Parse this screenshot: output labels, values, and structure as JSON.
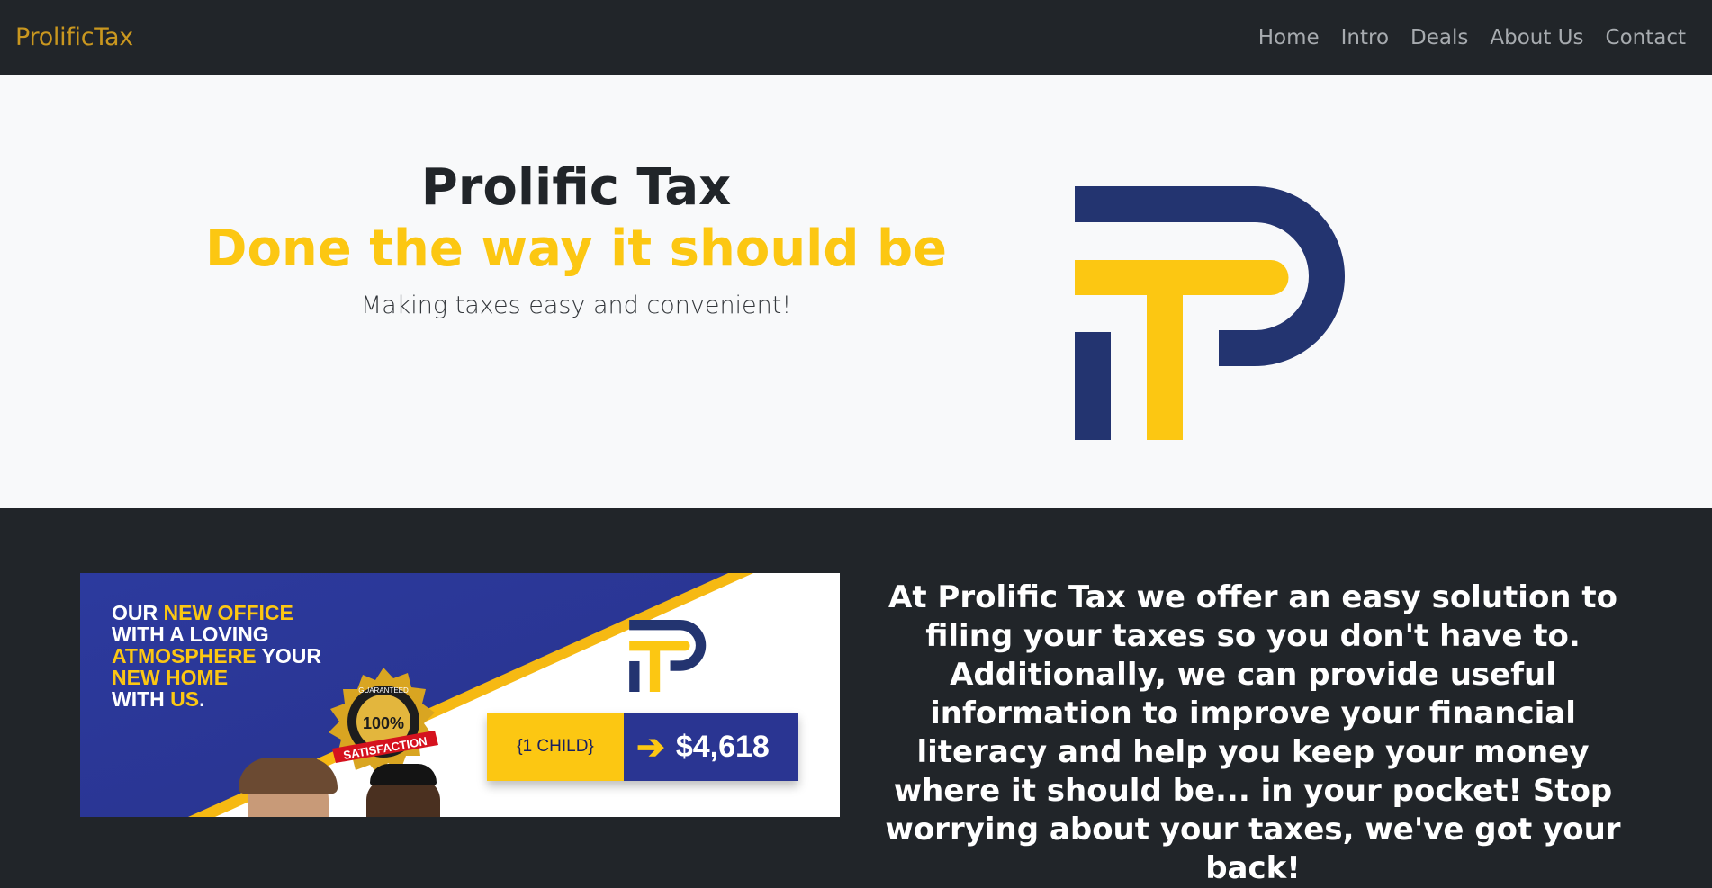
{
  "navbar": {
    "brand": "ProlificTax",
    "links": [
      "Home",
      "Intro",
      "Deals",
      "About Us",
      "Contact"
    ]
  },
  "hero": {
    "title": "Prolific Tax",
    "subtitle": "Done the way it should be",
    "tagline": "Making taxes easy and convenient!"
  },
  "promo": {
    "headline_lines": [
      [
        {
          "t": "OUR ",
          "h": false
        },
        {
          "t": "NEW OFFICE",
          "h": true
        }
      ],
      [
        {
          "t": "WITH A LOVING",
          "h": false
        }
      ],
      [
        {
          "t": "ATMOSPHERE",
          "h": true
        },
        {
          "t": " YOUR",
          "h": false
        }
      ],
      [
        {
          "t": "NEW HOME",
          "h": true
        }
      ],
      [
        {
          "t": "WITH ",
          "h": false
        },
        {
          "t": "US",
          "h": true
        },
        {
          "t": ".",
          "h": false
        }
      ]
    ],
    "seal_top": "GUARANTEED",
    "seal_percent": "100%",
    "seal_banner": "SATISFACTION",
    "deal_label": "{1 CHILD}",
    "deal_amount": "$4,618"
  },
  "about": {
    "text": "At Prolific Tax we offer an easy solution to filing your taxes so you don't have to. Additionally, we can provide useful information to improve your financial literacy and help you keep your money where it should be... in your pocket! Stop worrying about your taxes, we've got your back!"
  },
  "colors": {
    "navy": "#233470",
    "gold": "#fcc712",
    "dark": "#212529",
    "brand_text": "#c9971f"
  }
}
